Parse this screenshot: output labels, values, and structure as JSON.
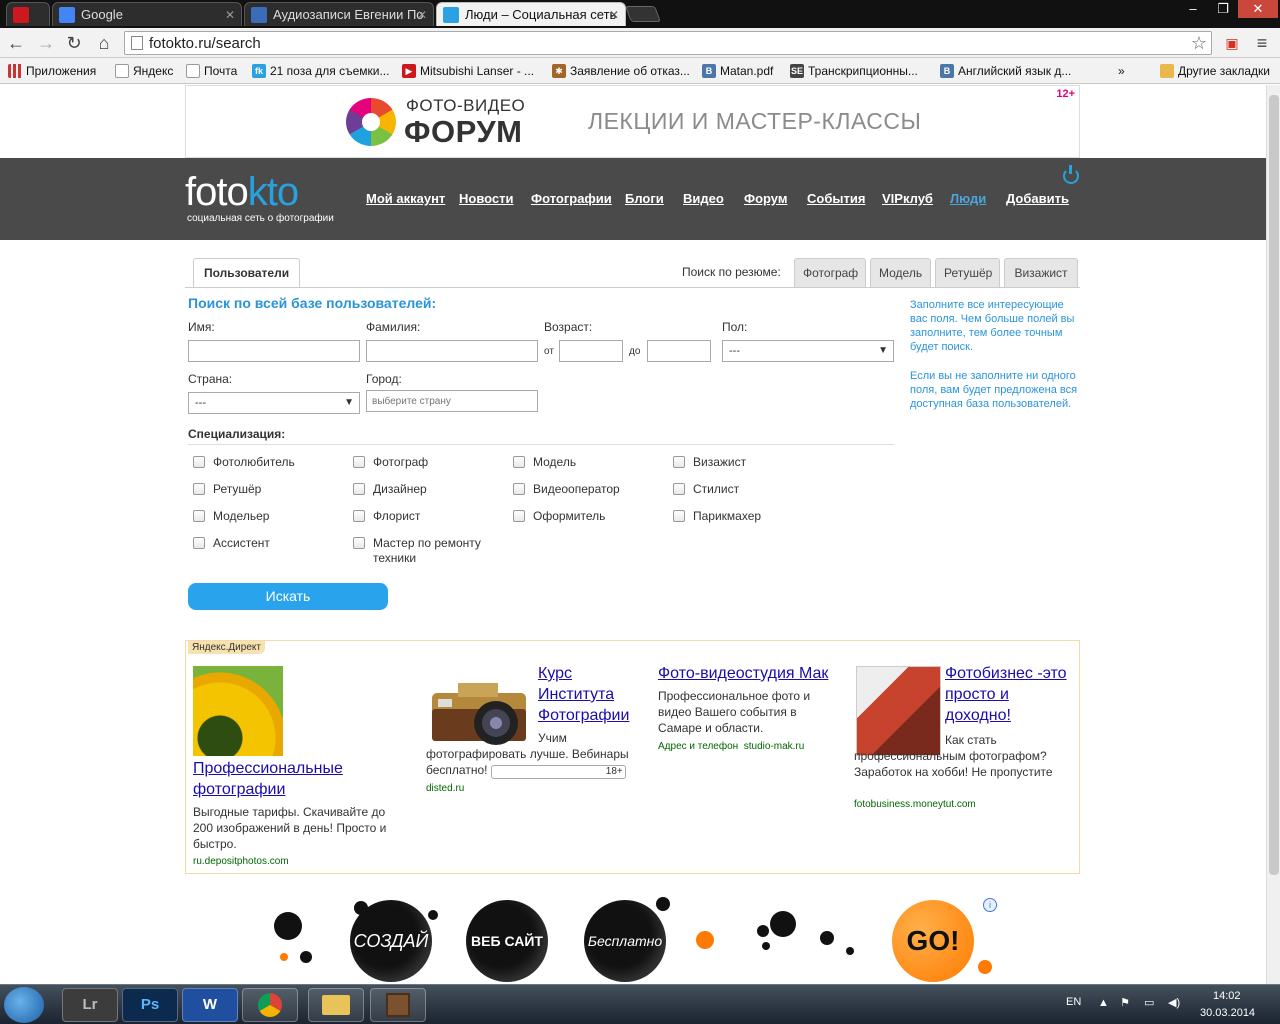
{
  "browser": {
    "tabs": [
      {
        "label": "",
        "favicon_color": "#cc181e"
      },
      {
        "label": "Google",
        "favicon_color": "#4285f4"
      },
      {
        "label": "Аудиозаписи Евгении По",
        "favicon_color": "#3b6cb7"
      },
      {
        "label": "Люди – Социальная сеть",
        "favicon_color": "#2aa1e0"
      }
    ],
    "url": "fotokto.ru/search",
    "bookmarks": [
      {
        "label": "Приложения",
        "icon": "apps-icon"
      },
      {
        "label": "Яндекс",
        "icon": "page-icon"
      },
      {
        "label": "Почта",
        "icon": "page-icon"
      },
      {
        "label": "21 поза для съемки...",
        "icon": "fk-icon"
      },
      {
        "label": "Mitsubishi Lanser - ...",
        "icon": "youtube-icon"
      },
      {
        "label": "Заявление об отказ...",
        "icon": "ornament-icon"
      },
      {
        "label": "Matan.pdf",
        "icon": "vk-icon"
      },
      {
        "label": "Транскрипционны...",
        "icon": "se-icon"
      },
      {
        "label": "Английский язык д...",
        "icon": "vk-icon"
      },
      {
        "label": "»",
        "icon": ""
      },
      {
        "label": "Другие закладки",
        "icon": "folder-icon"
      }
    ]
  },
  "top_banner": {
    "line1": "ФОТО-ВИДЕО",
    "line2": "ФОРУМ",
    "slogan": "ЛЕКЦИИ И МАСТЕР-КЛАССЫ",
    "age": "12+"
  },
  "site": {
    "logo_foto": "foto",
    "logo_kto": "kto",
    "tagline": "социальная сеть о фотографии",
    "nav": [
      "Мой аккаунт",
      "Новости",
      "Фотографии",
      "Блоги",
      "Видео",
      "Форум",
      "События",
      "VIPклуб",
      "Люди",
      "Добавить"
    ],
    "active_nav": "Люди"
  },
  "search": {
    "tab_users": "Пользователи",
    "resume_label": "Поиск по резюме:",
    "resume_tabs": [
      "Фотограф",
      "Модель",
      "Ретушёр",
      "Визажист"
    ],
    "title": "Поиск по всей базе пользователей:",
    "labels": {
      "name": "Имя:",
      "surname": "Фамилия:",
      "age": "Возраст:",
      "age_from": "от",
      "age_to": "до",
      "sex": "Пол:",
      "country": "Страна:",
      "city": "Город:"
    },
    "sex_value": "---",
    "country_value": "---",
    "city_placeholder": "выберите страну",
    "specialization_title": "Специализация:",
    "specializations": [
      [
        "Фотолюбитель",
        "Фотограф",
        "Модель",
        "Визажист"
      ],
      [
        "Ретушёр",
        "Дизайнер",
        "Видеооператор",
        "Стилист"
      ],
      [
        "Модельер",
        "Флорист",
        "Оформитель",
        "Парикмахер"
      ],
      [
        "Ассистент",
        "Мастер по ремонту техники"
      ]
    ],
    "button": "Искать",
    "hint1": "Заполните все интересующие вас поля. Чем больше полей вы заполните, тем более точным будет поиск.",
    "hint2": "Если вы не заполните ни одного поля, вам будет предложена вся доступная база пользователей."
  },
  "ads": {
    "label": "Яндекс.Директ",
    "items": [
      {
        "title": "Профессиональные фотографии",
        "text": "Выгодные тарифы. Скачивайте до 200 изображений в день! Просто и быстро.",
        "url": "ru.depositphotos.com"
      },
      {
        "title": "Курс Института Фотографии",
        "text": "Учим фотографировать лучше. Вебинары бесплатно!",
        "age": "18+",
        "url": "disted.ru"
      },
      {
        "title": "Фото-видеостудия Мак",
        "text": "Профессиональное фото и видео Вашего события в Самаре и области.",
        "extra": "Адрес и телефон",
        "url": "studio-mak.ru"
      },
      {
        "title": "Фотобизнес -это просто и доходно!",
        "text": "Как стать профессиональным фотографом? Заработок на хобби! Не пропустите",
        "url": "fotobusiness.moneytut.com"
      }
    ]
  },
  "bottom_banner": {
    "words": [
      "СОЗДАЙ",
      "ВЕБ САЙТ",
      "Бесплатно"
    ],
    "go": "GO!"
  },
  "taskbar": {
    "apps": [
      "Lr",
      "Ps",
      "W",
      "chrome",
      "explorer",
      "minecraft"
    ],
    "lang": "EN",
    "time": "14:02",
    "date": "30.03.2014"
  }
}
